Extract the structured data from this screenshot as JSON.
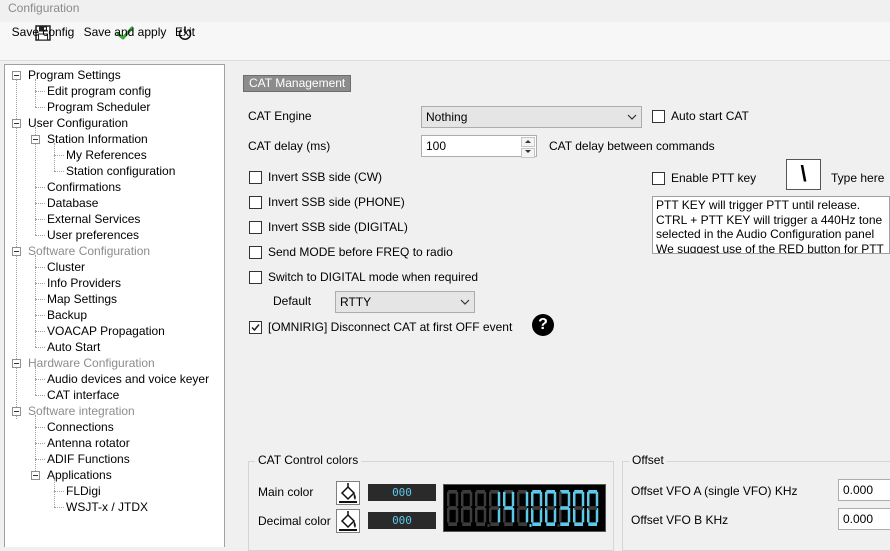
{
  "window": {
    "title": "Configuration"
  },
  "toolbar": {
    "save_config": "Save config",
    "save_apply": "Save and apply",
    "exit": "Exit"
  },
  "tree": {
    "program_settings": "Program Settings",
    "edit_program_config": "Edit program config",
    "program_scheduler": "Program Scheduler",
    "user_configuration": "User Configuration",
    "station_information": "Station Information",
    "my_references": "My References",
    "station_configuration": "Station configuration",
    "confirmations": "Confirmations",
    "database": "Database",
    "external_services": "External Services",
    "user_preferences": "User preferences",
    "software_configuration": "Software Configuration",
    "cluster": "Cluster",
    "info_providers": "Info Providers",
    "map_settings": "Map Settings",
    "backup": "Backup",
    "voacap": "VOACAP Propagation",
    "auto_start": "Auto Start",
    "hardware_configuration": "Hardware Configuration",
    "audio_devices": "Audio devices and voice keyer",
    "cat_interface": "CAT interface",
    "software_integration": "Software integration",
    "connections": "Connections",
    "antenna_rotator": "Antenna rotator",
    "adif_functions": "ADIF Functions",
    "applications": "Applications",
    "fldigi": "FLDigi",
    "wsjt": "WSJT-x / JTDX"
  },
  "cat": {
    "section_title": "CAT Management",
    "engine_label": "CAT Engine",
    "engine_value": "Nothing",
    "auto_start_label": "Auto start CAT",
    "delay_label": "CAT delay (ms)",
    "delay_value": "100",
    "delay_desc": "CAT delay between commands",
    "invert_cw": "Invert SSB side (CW)",
    "invert_phone": "Invert SSB side (PHONE)",
    "invert_digital": "Invert SSB side (DIGITAL)",
    "send_mode": "Send MODE before FREQ to radio",
    "switch_digital": "Switch to DIGITAL mode when required",
    "default_label": "Default",
    "default_value": "RTTY",
    "omnirig_label": "[OMNIRIG] Disconnect CAT at first OFF event",
    "omnirig_checked": true,
    "help_glyph": "?",
    "enable_ptt_label": "Enable PTT key",
    "ptt_key": "\\",
    "type_here": "Type here",
    "ptt_info": [
      "PTT KEY will trigger PTT until release.",
      "CTRL + PTT KEY will trigger a 440Hz tone",
      "selected in the Audio Configuration panel",
      "We suggest use of the RED button for PTT"
    ]
  },
  "colors": {
    "group_title": "CAT Control colors",
    "main_label": "Main color",
    "main_value": "000",
    "decimal_label": "Decimal color",
    "decimal_value": "000",
    "lcd_color": "#5ec8e8"
  },
  "offset": {
    "group_title": "Offset",
    "vfo_a_label": "Offset VFO A (single VFO) KHz",
    "vfo_a_value": "0.000",
    "vfo_b_label": "Offset VFO B KHz",
    "vfo_b_value": "0.000"
  }
}
